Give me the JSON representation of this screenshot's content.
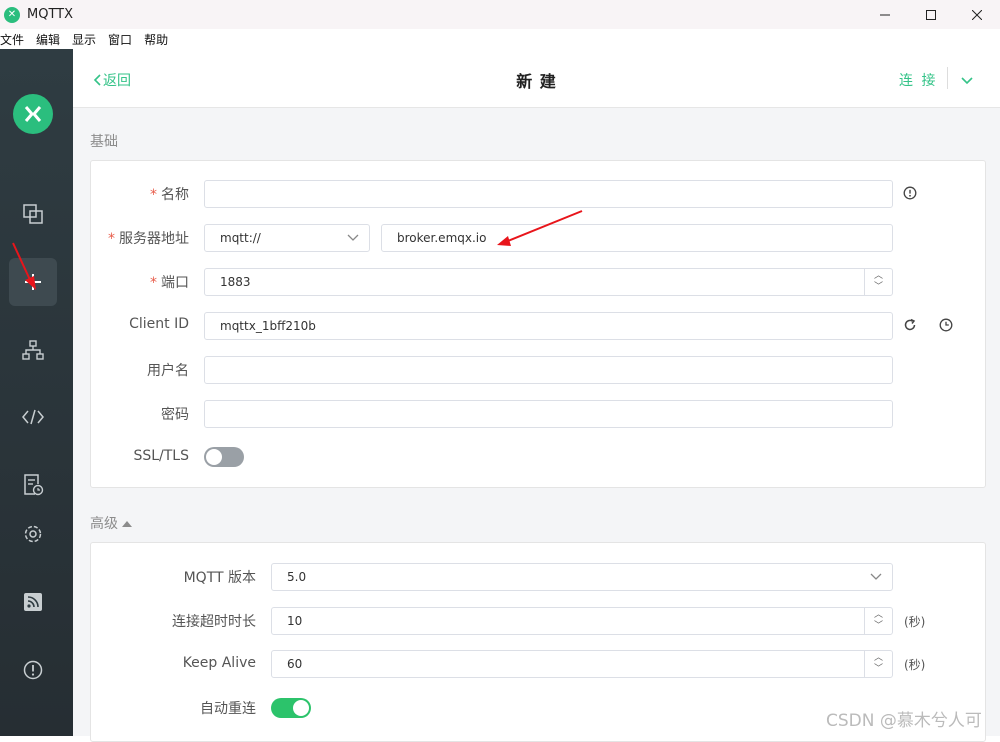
{
  "window": {
    "title": "MQTTX",
    "logo_glyph": "✕"
  },
  "menu": [
    "文件",
    "编辑",
    "显示",
    "窗口",
    "帮助"
  ],
  "sidebar": {
    "items": [
      "connections",
      "new-connection",
      "scripts-tree",
      "script",
      "log",
      "settings",
      "feed",
      "about"
    ]
  },
  "topbar": {
    "back_label": "返回",
    "title": "新 建",
    "connect_label": "连 接"
  },
  "basic": {
    "section_title": "基础",
    "name": {
      "label": "名称",
      "value": ""
    },
    "host": {
      "label": "服务器地址",
      "protocol": "mqtt://",
      "value": "broker.emqx.io"
    },
    "port": {
      "label": "端口",
      "value": "1883"
    },
    "client_id": {
      "label": "Client ID",
      "value": "mqttx_1bff210b"
    },
    "username": {
      "label": "用户名",
      "value": ""
    },
    "password": {
      "label": "密码",
      "value": ""
    },
    "ssl": {
      "label": "SSL/TLS",
      "enabled": false
    },
    "required_mark": "*"
  },
  "advanced": {
    "section_title": "高级",
    "mqtt_version": {
      "label": "MQTT 版本",
      "value": "5.0"
    },
    "connect_timeout": {
      "label": "连接超时时长",
      "value": "10",
      "unit": "(秒)"
    },
    "keep_alive": {
      "label": "Keep Alive",
      "value": "60",
      "unit": "(秒)"
    },
    "auto_reconnect": {
      "label": "自动重连",
      "enabled": true
    }
  },
  "colors": {
    "accent": "#34c388",
    "required": "#e85c4a",
    "annotation": "#e8151b"
  },
  "watermark": "CSDN @慕木兮人可"
}
